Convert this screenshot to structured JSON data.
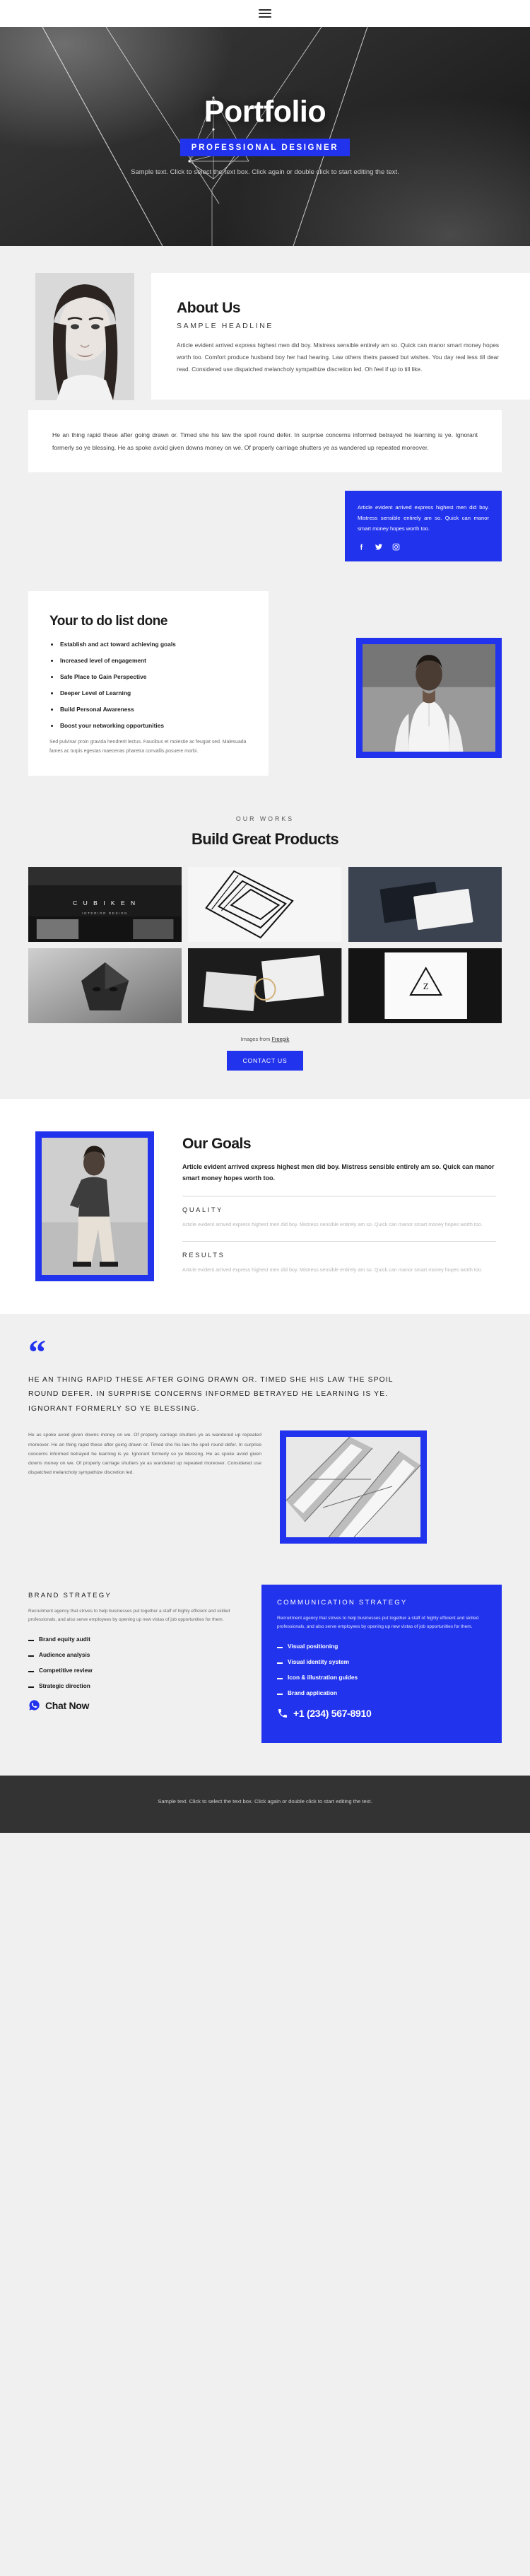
{
  "brand_color": "#2233ee",
  "nav": {
    "menu_label": "menu-toggle"
  },
  "hero": {
    "title": "Portfolio",
    "badge": "PROFESSIONAL DESIGNER",
    "subtitle": "Sample text. Click to select the text box. Click again or double click to start editing the text."
  },
  "about": {
    "heading": "About Us",
    "subheading": "SAMPLE HEADLINE",
    "paragraph": "Article evident arrived express highest men did boy. Mistress sensible entirely am so. Quick can manor smart money hopes worth too. Comfort produce husband boy her had hearing. Law others theirs passed but wishes. You day real less till dear read. Considered use dispatched melancholy sympathize discretion led. Oh feel if up to till like."
  },
  "wide_card": {
    "paragraph": "He an thing rapid these after going drawn or. Timed she his law the spoil round defer. In surprise concerns informed betrayed he learning is ye. Ignorant formerly so ye blessing. He as spoke avoid given downs money on we. Of properly carriage shutters ye as wandered up repeated moreover."
  },
  "social_box": {
    "paragraph": "Article evident arrived express highest men did boy. Mistress sensible entirely am so. Quick can manor smart money hopes worth too.",
    "icons": [
      "facebook-icon",
      "twitter-icon",
      "instagram-icon"
    ]
  },
  "todo": {
    "heading": "Your to do list done",
    "items": [
      "Establish and act toward achieving goals",
      "Increased level of engagement",
      "Safe Place to Gain Perspective",
      "Deeper Level of Learning",
      "Build Personal Awareness",
      "Boost your networking opportunities"
    ],
    "note": "Sed pulvinar proin gravida hendrerit lectus. Faucibus et molestie ac feugiat sed. Malesuada fames ac turpis egestas maecenas pharetra convallis posuere morbi."
  },
  "works": {
    "eyebrow": "OUR WORKS",
    "heading": "Build Great Products",
    "tiles": [
      {
        "name": "work-tile-cubiken",
        "label": "C U B I K E N",
        "sublabel": "INTERIOR DESIGN"
      },
      {
        "name": "work-tile-stairs",
        "label": "",
        "sublabel": ""
      },
      {
        "name": "work-tile-cards",
        "label": "",
        "sublabel": ""
      },
      {
        "name": "work-tile-mask",
        "label": "",
        "sublabel": ""
      },
      {
        "name": "work-tile-stationery",
        "label": "",
        "sublabel": ""
      },
      {
        "name": "work-tile-poster",
        "label": "",
        "sublabel": ""
      }
    ],
    "credit_prefix": "Images from ",
    "credit_link": "Freepik",
    "cta": "CONTACT US"
  },
  "goals": {
    "heading": "Our Goals",
    "lead": "Article evident arrived express highest men did boy. Mistress sensible entirely am so. Quick can manor smart money hopes worth too.",
    "items": [
      {
        "title": "QUALITY",
        "text": "Article evident arrived express highest men did boy. Mistress sensible entirely am so. Quick can manor smart money hopes worth too."
      },
      {
        "title": "RESULTS",
        "text": "Article evident arrived express highest men did boy. Mistress sensible entirely am so. Quick can manor smart money hopes worth too."
      }
    ]
  },
  "quote": {
    "mark": "“",
    "heading": "HE AN THING RAPID THESE AFTER GOING DRAWN OR. TIMED SHE HIS LAW THE SPOIL ROUND DEFER. IN SURPRISE CONCERNS INFORMED BETRAYED HE LEARNING IS YE. IGNORANT FORMERLY SO YE BLESSING.",
    "paragraph": "He as spoke avoid given downs money on we. Of properly carriage shutters ye as wandered up repeated moreover. He an thing rapid these after going drawn or. Timed she his law the spoil round defer. In surprise concerns informed betrayed he learning is ye. Ignorant formerly so ye blessing. He as spoke avoid given downs money on we. Of properly carriage shutters ye as wandered up repeated moreover. Considered use dispatched melancholy sympathize discretion led."
  },
  "strategy": {
    "brand": {
      "title": "BRAND STRATEGY",
      "text": "Recruitment agency that strives to help businesses put together a staff of highly efficient and skilled professionals, and also serve employees by opening up new vistas of job opportunities for them.",
      "items": [
        "Brand equity audit",
        "Audience analysis",
        "Competitive review",
        "Strategic direction"
      ],
      "chat_label": "Chat Now",
      "chat_icon": "whatsapp-icon"
    },
    "communication": {
      "title": "COMMUNICATION STRATEGY",
      "text": "Recruitment agency that strives to help businesses put together a staff of highly efficient and skilled professionals, and also serve employees by opening up new vistas of job opportunities for them.",
      "items": [
        "Visual positioning",
        "Visual identity system",
        "Icon & illustration guides",
        "Brand application"
      ],
      "phone": "+1 (234) 567-8910",
      "phone_icon": "phone-icon"
    }
  },
  "footer": {
    "text": "Sample text. Click to select the text box. Click again or double click to start editing the text."
  }
}
